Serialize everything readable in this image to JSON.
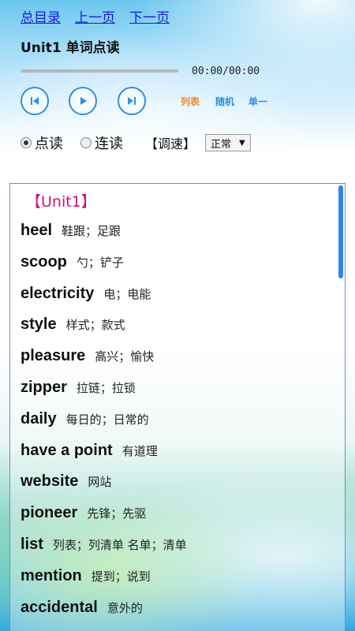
{
  "nav": {
    "contents": "总目录",
    "prev": "上一页",
    "next": "下一页"
  },
  "title": "Unit1 单词点读",
  "player": {
    "time": "00:00/00:00",
    "modes": [
      "列表",
      "随机",
      "单一"
    ],
    "mode_colors": [
      "#f08a1c",
      "#2f8fe0",
      "#2f8fe0"
    ]
  },
  "reading": {
    "options": [
      "点读",
      "连读"
    ],
    "selected_index": 0,
    "speed_label": "【调速】",
    "speed_value": "正常"
  },
  "list": {
    "unit_heading": "【Unit1】",
    "words": [
      {
        "en": "heel",
        "cn": "鞋跟；足跟"
      },
      {
        "en": "scoop",
        "cn": "勺；铲子"
      },
      {
        "en": "electricity",
        "cn": "电；电能"
      },
      {
        "en": "style",
        "cn": "样式；款式"
      },
      {
        "en": "pleasure",
        "cn": "高兴；愉快"
      },
      {
        "en": "zipper",
        "cn": "拉链；拉锁"
      },
      {
        "en": "daily",
        "cn": "每日的；日常的"
      },
      {
        "en": "have a point",
        "cn": "有道理"
      },
      {
        "en": "website",
        "cn": "网站"
      },
      {
        "en": "pioneer",
        "cn": "先锋；先驱"
      },
      {
        "en": "list",
        "cn": "列表；列清单 名单；清单"
      },
      {
        "en": "mention",
        "cn": "提到；说到"
      },
      {
        "en": "accidental",
        "cn": "意外的"
      }
    ]
  }
}
